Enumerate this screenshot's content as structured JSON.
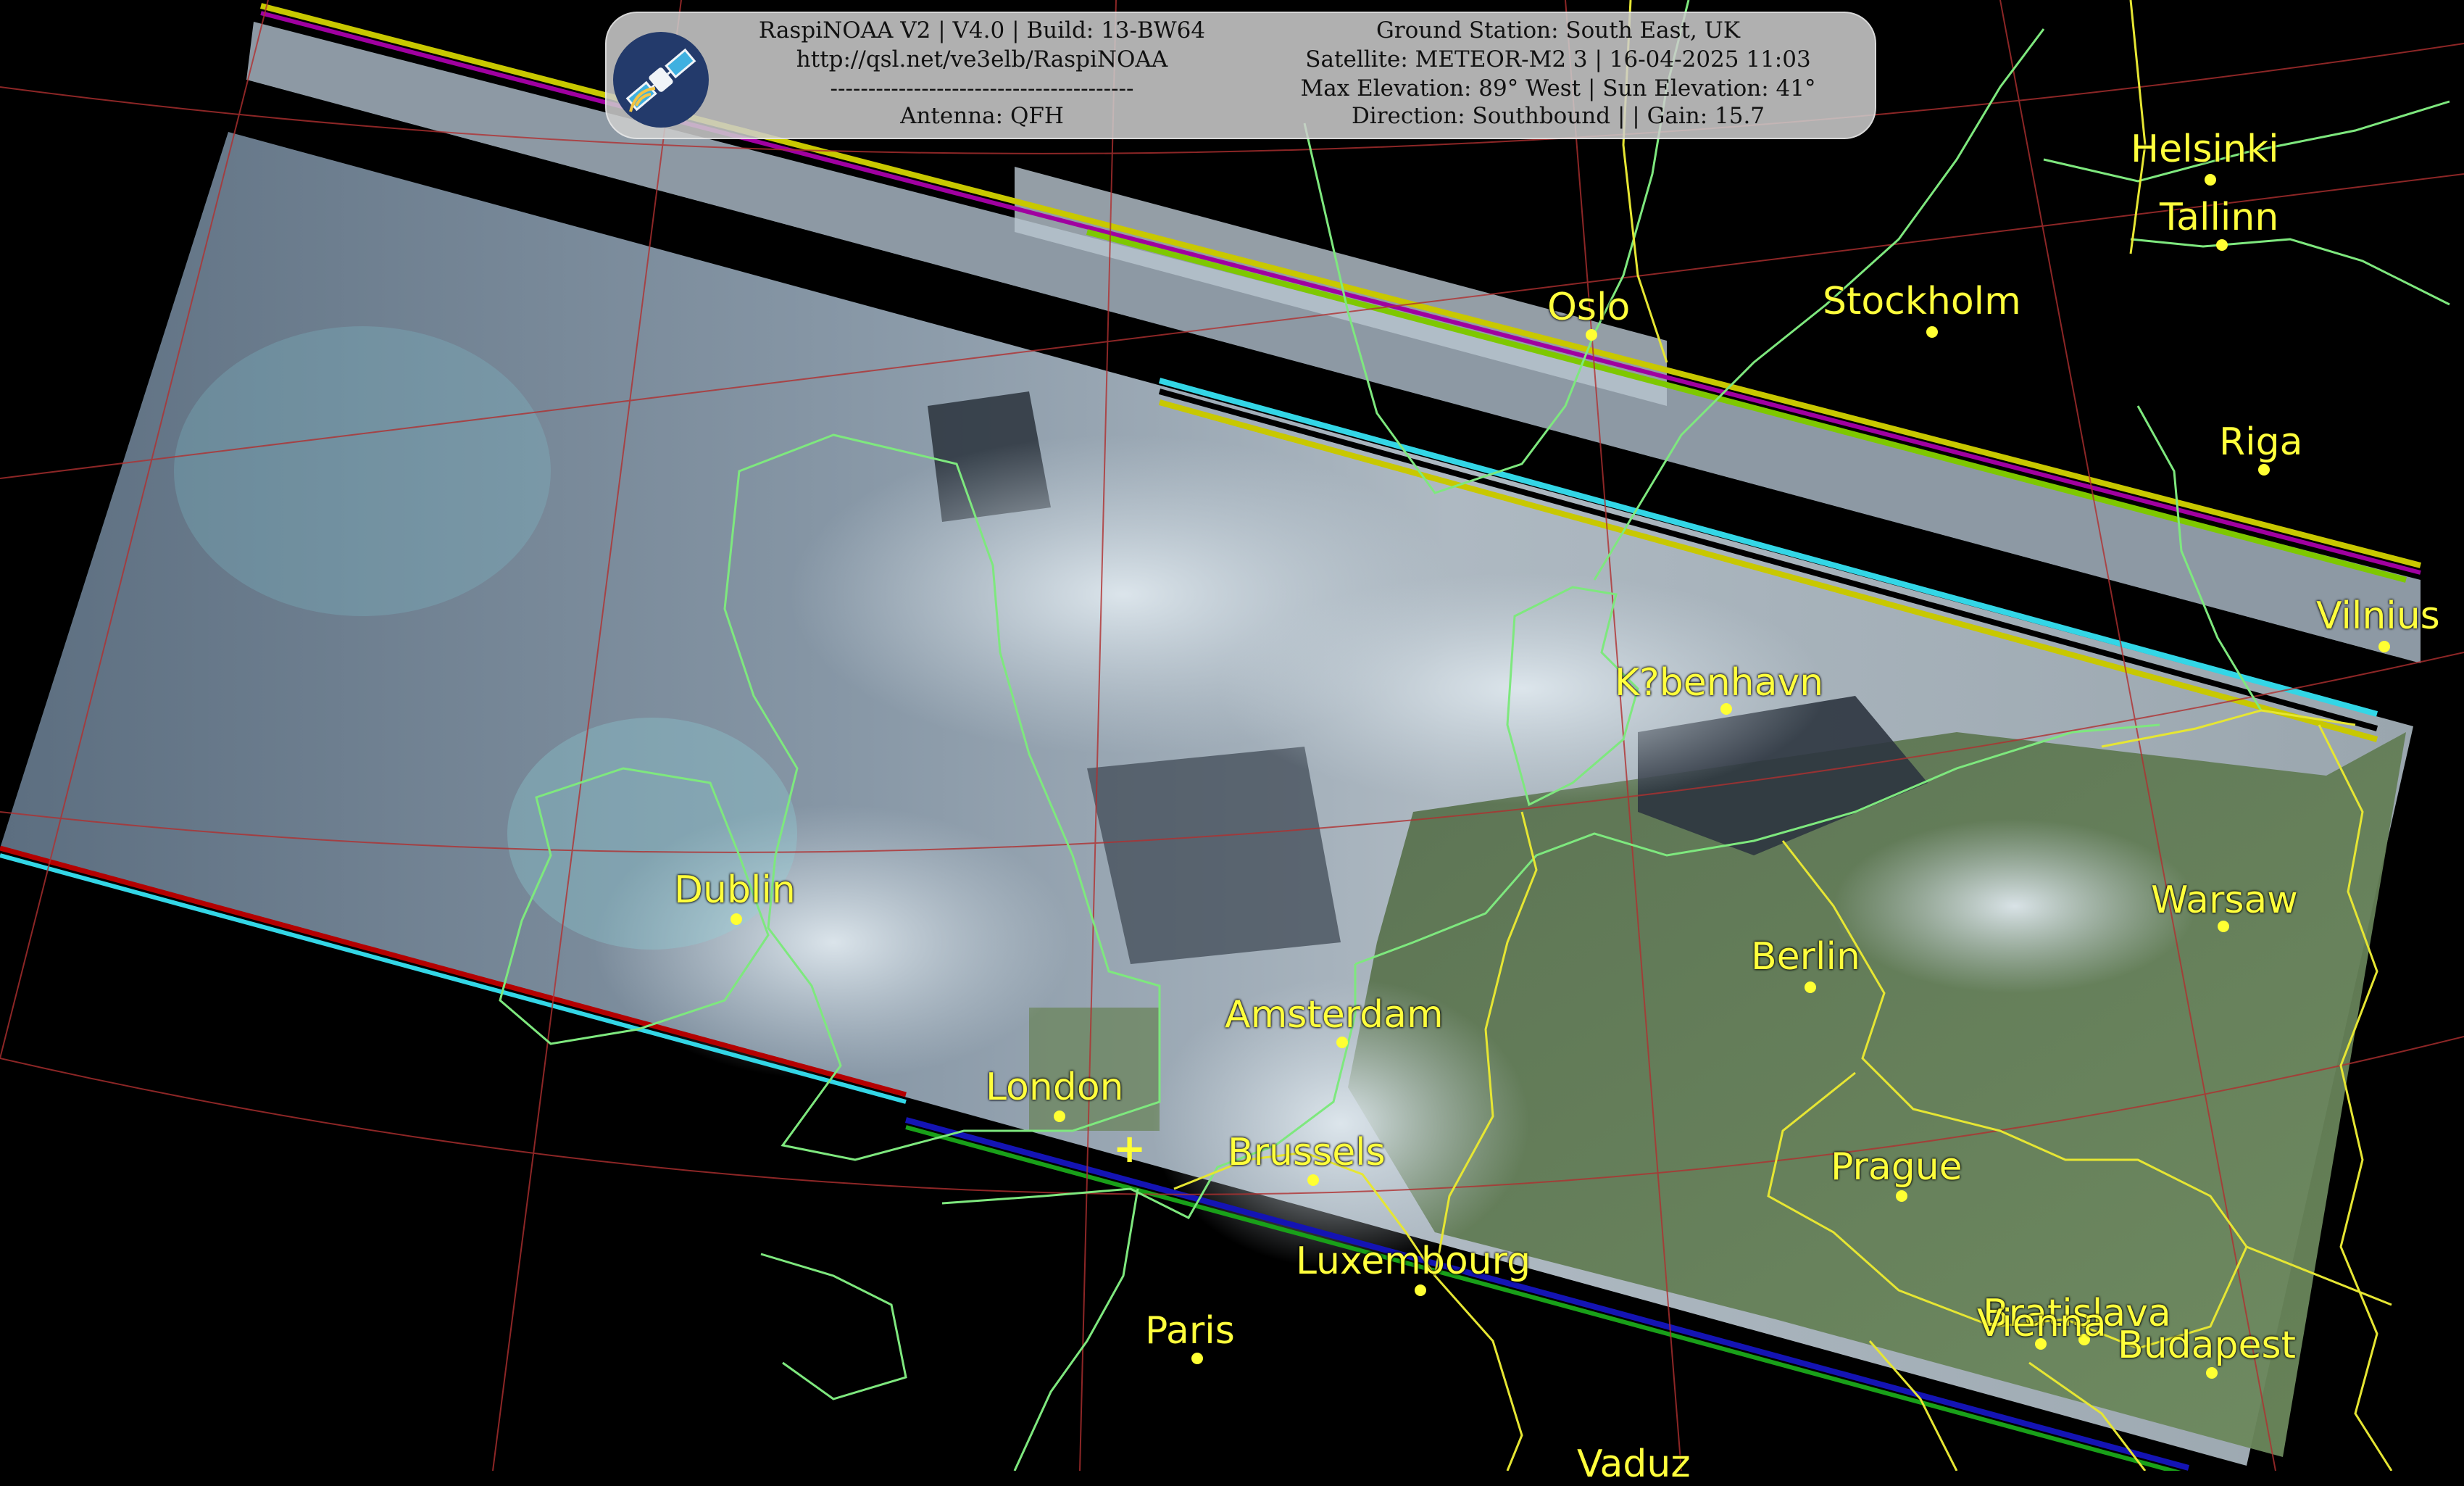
{
  "header": {
    "line1_left": "RaspiNOAA V2 | V4.0 | Build: 13-BW64",
    "line2_left": "http://qsl.net/ve3elb/RaspiNOAA",
    "line3_left": "----------------------------------------",
    "line4_left": "Antenna: QFH",
    "line1_right": "Ground Station: South East, UK",
    "line2_right": "Satellite: METEOR-M2 3 | 16-04-2025 11:03",
    "line3_right": "Max Elevation: 89° West | Sun Elevation: 41°",
    "line4_right": "Direction: Southbound | | Gain: 15.7",
    "logo_icon": "satellite-icon"
  },
  "cities": [
    {
      "name": "Helsinki"
    },
    {
      "name": "Tallinn"
    },
    {
      "name": "Stockholm"
    },
    {
      "name": "Oslo"
    },
    {
      "name": "Riga"
    },
    {
      "name": "Vilnius"
    },
    {
      "name": "K?benhavn"
    },
    {
      "name": "Dublin"
    },
    {
      "name": "Warsaw"
    },
    {
      "name": "Berlin"
    },
    {
      "name": "Amsterdam"
    },
    {
      "name": "London"
    },
    {
      "name": "Brussels"
    },
    {
      "name": "Prague"
    },
    {
      "name": "Luxembourg"
    },
    {
      "name": "Bratislava"
    },
    {
      "name": "Vienna"
    },
    {
      "name": "Budapest"
    },
    {
      "name": "Paris"
    },
    {
      "name": "Vaduz"
    }
  ],
  "ground_station_marker": "+",
  "colors": {
    "background": "#000000",
    "coastline": "#7ee87e",
    "border": "#e6e633",
    "graticule": "#b03030",
    "city_label": "#ffff3c",
    "city_dot": "#ffff33",
    "header_bg": "#cdcdcd",
    "strip_cyan": "#33d6e6",
    "strip_yellow": "#c8c800",
    "strip_blue": "#1414b4",
    "strip_red": "#b40000",
    "strip_green": "#19a019"
  }
}
